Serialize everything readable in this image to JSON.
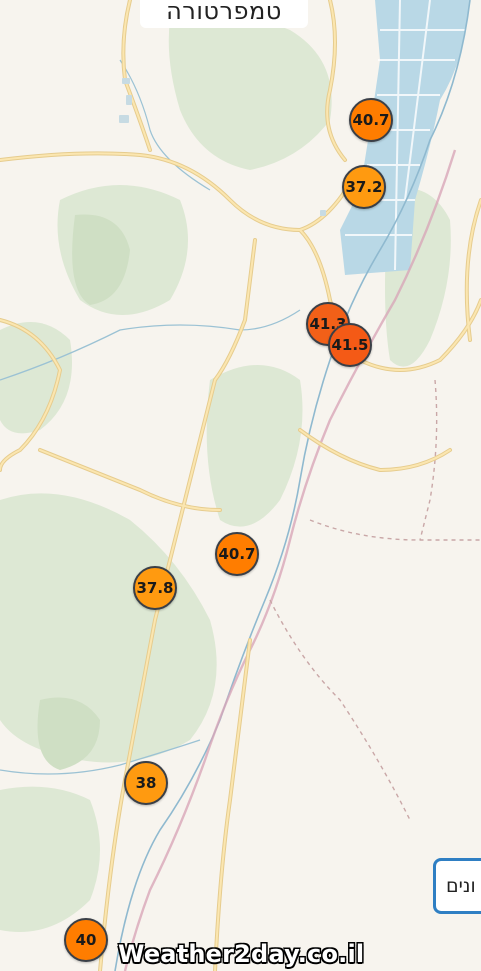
{
  "header": {
    "title": "טמפרטורה"
  },
  "map": {
    "colors": {
      "land": "#f7f4ee",
      "vegetation": "#dde8d4",
      "vegetation_dark": "#cfdfc4",
      "water": "#b9d8e6",
      "road_outline": "#e6cc8e",
      "road_fill": "#fbe6b0",
      "river": "#8fb9cf",
      "border_dashed": "#c9a7a7",
      "pink_line": "#d8a6b8"
    }
  },
  "markers": [
    {
      "id": "m1",
      "value": "40.7",
      "color": "#ff7d00"
    },
    {
      "id": "m2",
      "value": "37.2",
      "color": "#ff9a10"
    },
    {
      "id": "m3",
      "value": "41.3",
      "color": "#f26018"
    },
    {
      "id": "m4",
      "value": "41.5",
      "color": "#f45a16"
    },
    {
      "id": "m5",
      "value": "40.7",
      "color": "#ff7d00"
    },
    {
      "id": "m6",
      "value": "37.8",
      "color": "#ff9a10"
    },
    {
      "id": "m7",
      "value": "38",
      "color": "#ff9a10"
    },
    {
      "id": "m8",
      "value": "40",
      "color": "#ff7d00"
    }
  ],
  "legend_button": {
    "label": "ונים"
  },
  "watermark": "Weather2day.co.il"
}
